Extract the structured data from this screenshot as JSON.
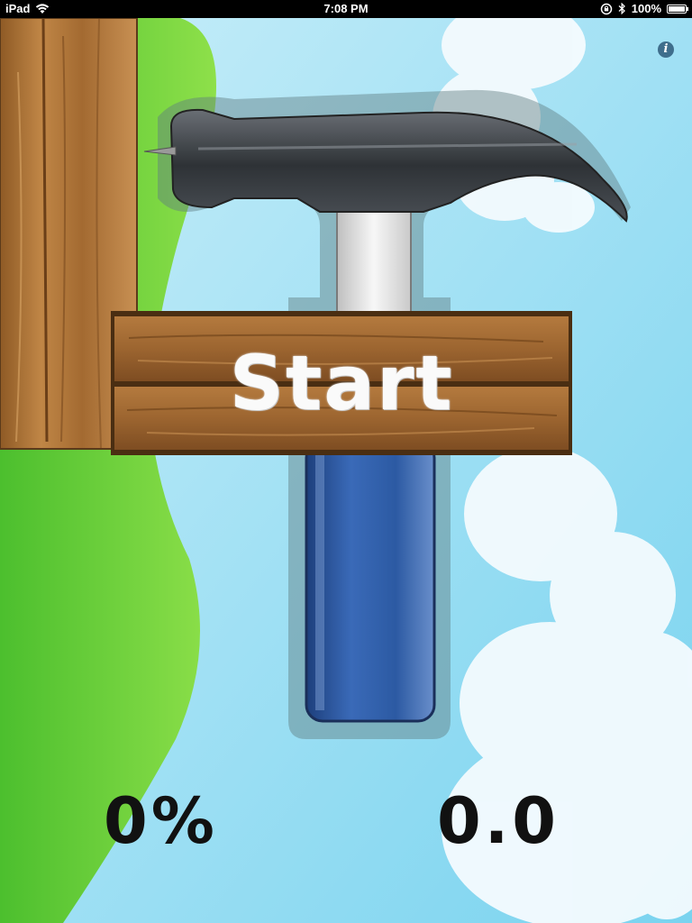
{
  "status_bar": {
    "device": "iPad",
    "time": "7:08 PM",
    "battery_percent": "100%"
  },
  "screen": {
    "start_label": "Start",
    "info_label": "i",
    "progress_percent": "0%",
    "score": "0.0"
  },
  "icons": [
    "wifi-icon",
    "lock-rotation-icon",
    "bluetooth-icon",
    "battery-icon",
    "info-icon",
    "hammer-icon",
    "wooden-post",
    "cloud"
  ],
  "colors": {
    "sky": "#8dd6f0",
    "grass": "#6cc63a",
    "wood": "#b07a3c",
    "hammer_handle": "#2f5aa0",
    "hammer_head": "#3a3f45"
  }
}
